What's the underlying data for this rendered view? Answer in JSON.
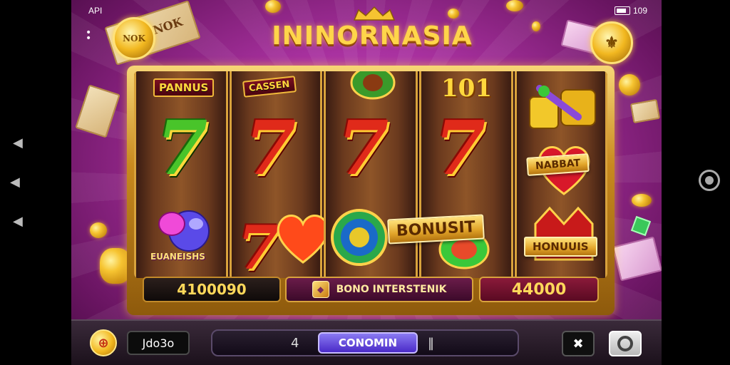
{
  "status_bar": {
    "left_text": "API",
    "right_text": "109"
  },
  "game": {
    "title": "ININORNASIA",
    "medallion_left": "NOK",
    "bill_left": "NOK"
  },
  "reels": [
    {
      "label": "PANNUS",
      "top_symbol": "7",
      "top_color": "green",
      "bottom_label": "EUANEISHS"
    },
    {
      "label": "CASSEN",
      "top_symbol": "7",
      "top_color": "red",
      "bottom_symbol": "7"
    },
    {
      "label": "",
      "top_symbol": "7",
      "top_color": "red",
      "bottom_label": ""
    },
    {
      "label": "101",
      "top_symbol": "7",
      "top_color": "red",
      "bottom_label": "BONUSIT"
    },
    {
      "label": "",
      "top_symbol": "",
      "middle_label": "NABBAT",
      "bottom_label": "HONUUIS"
    }
  ],
  "panels": {
    "left_value": "4100090",
    "center_text": "BONO INTERSTENIK",
    "right_value": "44000"
  },
  "controls": {
    "coin_symbol": "⊕",
    "balance": "Jdo3o",
    "left_glyph": "4",
    "spin_label": "CONOMIN",
    "right_glyph": "‖",
    "close_symbol": "✖"
  },
  "colors": {
    "background": "#a8319f",
    "frame_gold": "#d8a23c",
    "title_gold": "#ffd54a",
    "spin_button": "#5a3ad8"
  }
}
